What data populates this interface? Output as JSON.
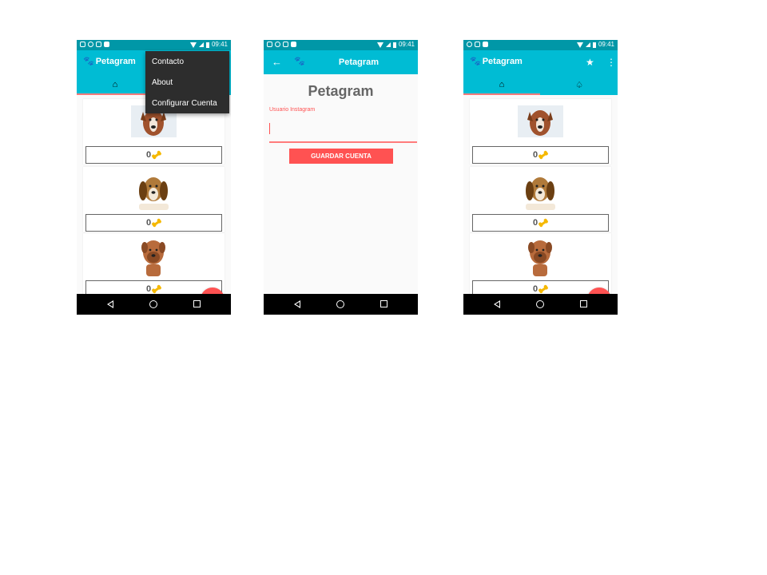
{
  "screens": {
    "feed_menu": {
      "status_time": "09:41",
      "brand": "Petagram",
      "menu": [
        "Contacto",
        "About",
        "Configurar Cuenta"
      ],
      "cards": [
        {
          "likes": "0",
          "icon": "bone-icon"
        },
        {
          "likes": "0",
          "icon": "bone-icon"
        },
        {
          "likes": "0",
          "icon": "bone-icon"
        }
      ]
    },
    "account_form": {
      "status_time": "09:41",
      "title": "Petagram",
      "form_title": "Petagram",
      "field_label": "Usuario Instagram",
      "field_value": "",
      "save_label": "GUARDAR CUENTA"
    },
    "feed_main": {
      "status_time": "09:41",
      "brand": "Petagram",
      "cards": [
        {
          "likes": "0",
          "icon": "bone-icon"
        },
        {
          "likes": "0",
          "icon": "bone-icon"
        },
        {
          "likes": "0",
          "icon": "bone-icon"
        }
      ]
    }
  },
  "colors": {
    "status_bar": "#0097a7",
    "app_bar": "#00bcd4",
    "accent": "#ff5252",
    "bone": "#f5b800"
  }
}
